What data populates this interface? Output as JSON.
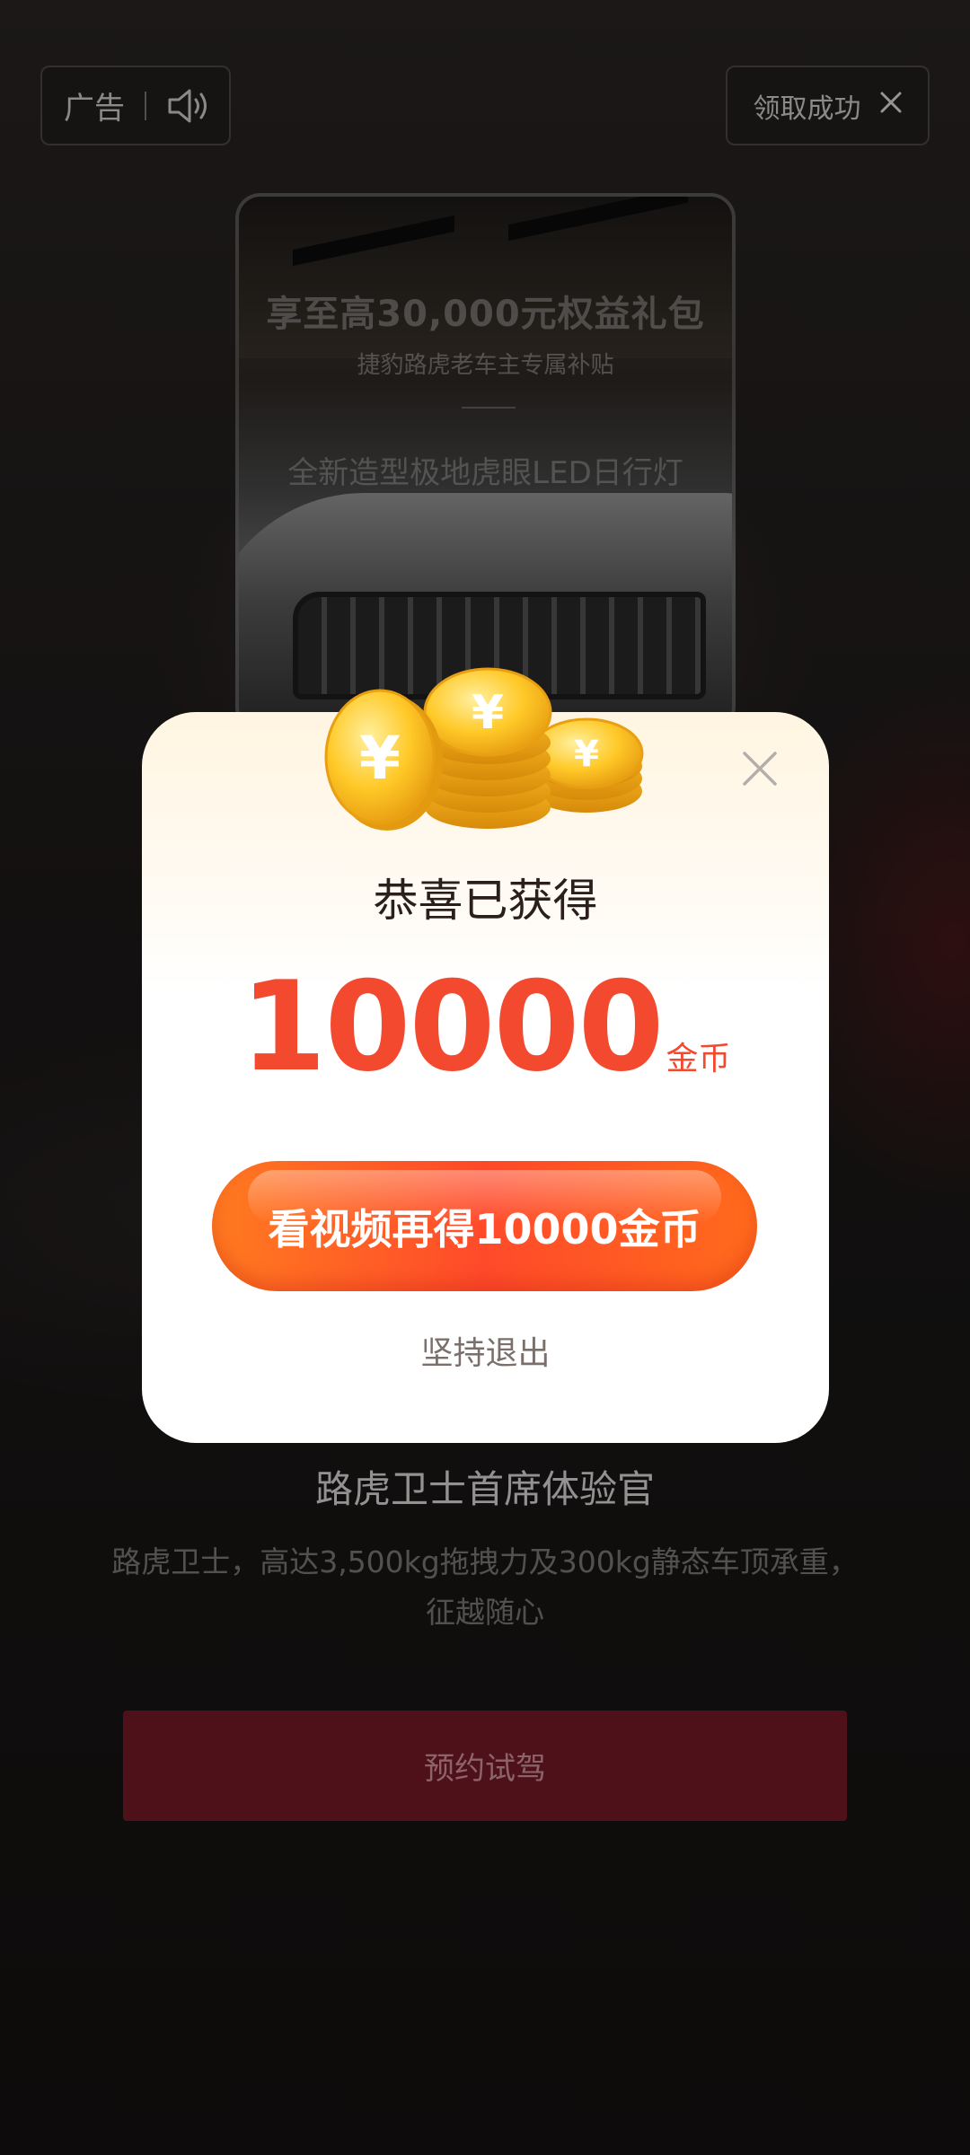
{
  "ad_badge": {
    "label": "广告",
    "sound_icon": "speaker-icon"
  },
  "reward_status": {
    "label": "领取成功",
    "close_icon": "close-icon"
  },
  "car_preview": {
    "headline": "享至高30,000元权益礼包",
    "subheadline": "捷豹路虎老车主专属补贴",
    "feature": "全新造型极地虎眼LED日行灯"
  },
  "ad_info": {
    "title": "路虎卫士首席体验官",
    "description": "路虎卫士，高达3,500kg拖拽力及300kg静态车顶承重，征越随心",
    "cta_label": "预约试驾"
  },
  "reward_modal": {
    "title": "恭喜已获得",
    "amount": "10000",
    "unit": "金币",
    "watch_button_label": "看视频再得10000金币",
    "quit_label": "坚持退出",
    "close_icon": "close-icon",
    "coin_icon": "gold-coins-icon"
  },
  "colors": {
    "accent_red": "#f2492f",
    "cta_orange": "#ff7a20",
    "book_button_bg": "#4e1019"
  }
}
